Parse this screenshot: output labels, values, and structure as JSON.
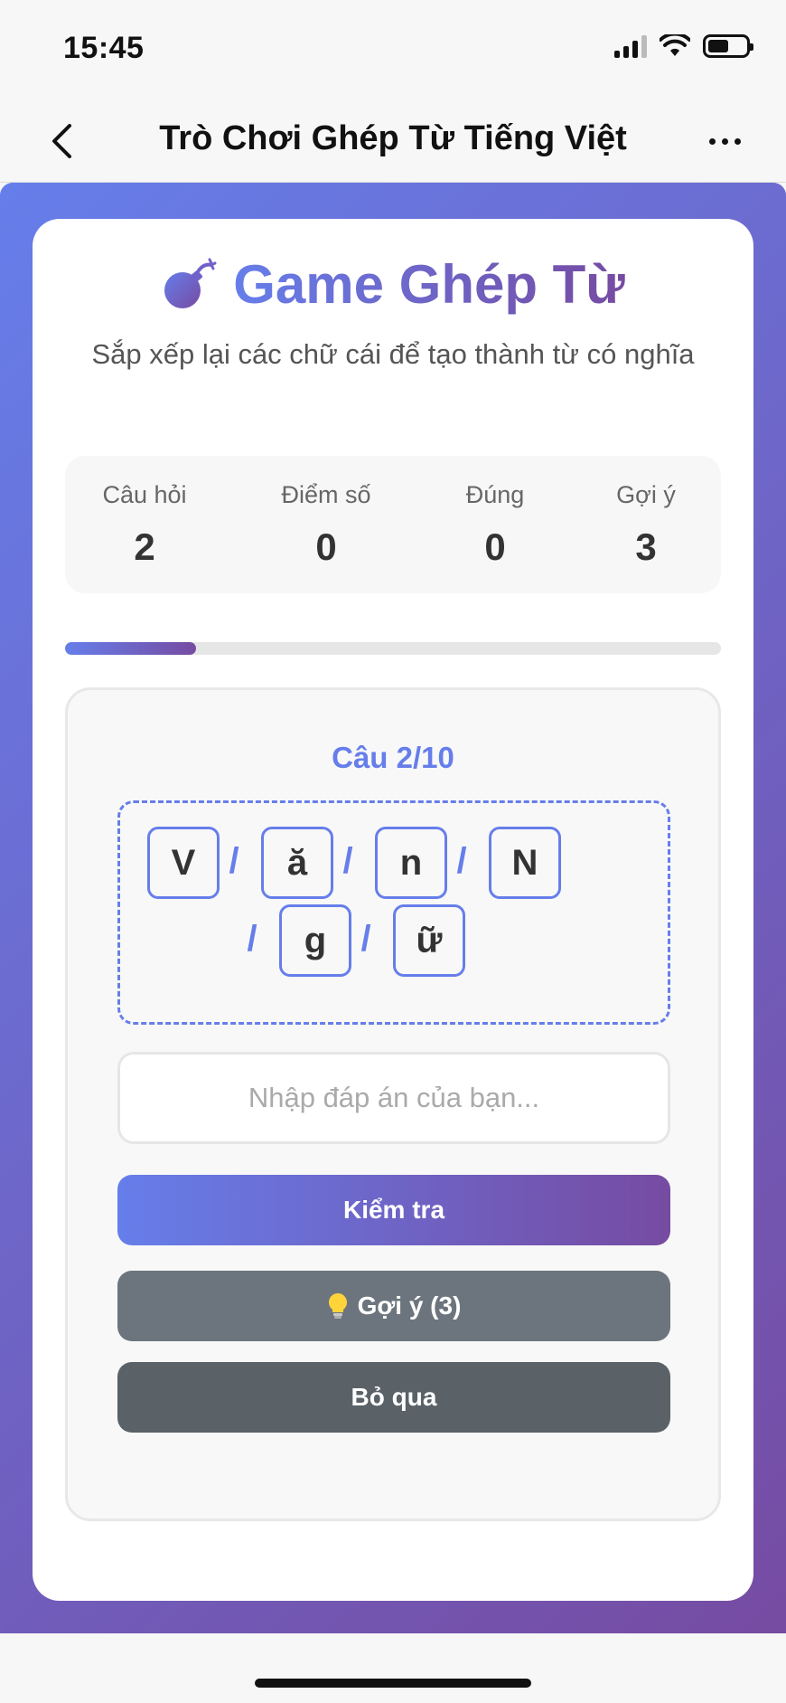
{
  "status_bar": {
    "time": "15:45"
  },
  "nav": {
    "title": "Trò Chơi Ghép Từ Tiếng Việt"
  },
  "header": {
    "title": "Game Ghép Từ",
    "subtitle": "Sắp xếp lại các chữ cái để tạo thành từ có nghĩa"
  },
  "stats": [
    {
      "label": "Câu hỏi",
      "value": "2"
    },
    {
      "label": "Điểm số",
      "value": "0"
    },
    {
      "label": "Đúng",
      "value": "0"
    },
    {
      "label": "Gợi ý",
      "value": "3"
    }
  ],
  "progress": {
    "fraction": 0.2
  },
  "game": {
    "question_label": "Câu 2/10",
    "letters": [
      "V",
      "ă",
      "n",
      "N",
      "g",
      "ữ"
    ],
    "separator": "/",
    "answer_placeholder": "Nhập đáp án của bạn...",
    "check_label": "Kiểm tra",
    "hint_label": "Gợi ý (3)",
    "skip_label": "Bỏ qua"
  },
  "colors": {
    "accent_start": "#667eea",
    "accent_end": "#764ba2",
    "hint_button": "#6c757d",
    "skip_button": "#5a6268"
  },
  "icons": {
    "title": "bomb-icon",
    "hint": "lightbulb-icon"
  }
}
